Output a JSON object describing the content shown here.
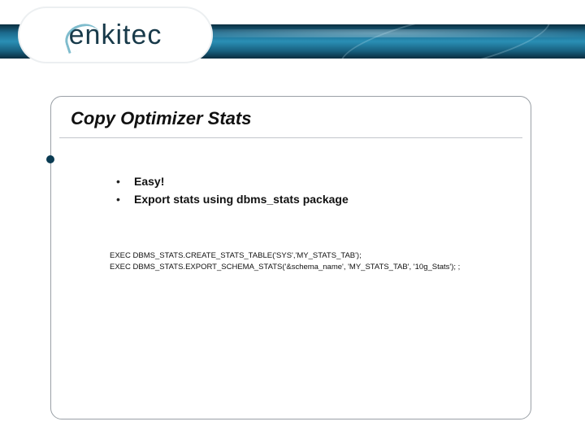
{
  "logo": {
    "text": "enkitec"
  },
  "slide": {
    "title": "Copy Optimizer Stats",
    "bullets": [
      "Easy!",
      "Export stats using dbms_stats package"
    ],
    "code_lines": [
      "EXEC DBMS_STATS.CREATE_STATS_TABLE('SYS','MY_STATS_TAB');",
      "EXEC DBMS_STATS.EXPORT_SCHEMA_STATS('&schema_name', 'MY_STATS_TAB', '10g_Stats'); ;"
    ]
  }
}
